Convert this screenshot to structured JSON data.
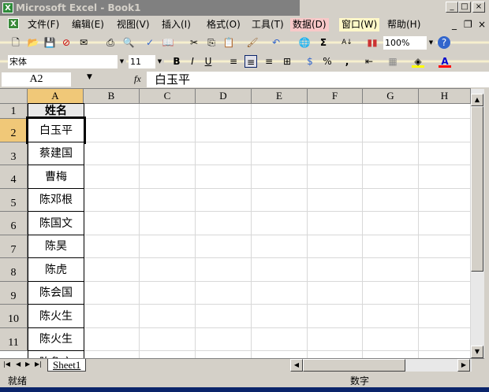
{
  "window": {
    "title": "Microsoft Excel - Book1"
  },
  "menu": [
    {
      "label": "文件(F)"
    },
    {
      "label": "编辑(E)"
    },
    {
      "label": "视图(V)"
    },
    {
      "label": "插入(I)"
    },
    {
      "label": "格式(O)"
    },
    {
      "label": "工具(T)"
    },
    {
      "label": "数据(D)"
    },
    {
      "label": "窗口(W)"
    },
    {
      "label": "帮助(H)"
    }
  ],
  "toolbar": {
    "zoom": "100%",
    "font": "宋体",
    "size": "11",
    "bold": "B",
    "italic": "I",
    "underline": "U",
    "percent": "%",
    "comma": ",",
    "sum": "Σ",
    "font_color_icon": "A",
    "highlight_color": "#ffff00",
    "font_color": "#ff0000"
  },
  "formula": {
    "name_box": "A2",
    "fx": "fx",
    "value": "白玉平"
  },
  "columns": [
    "A",
    "B",
    "C",
    "D",
    "E",
    "F",
    "G",
    "H"
  ],
  "rows": [
    "1",
    "2",
    "3",
    "4",
    "5",
    "6",
    "7",
    "8",
    "9",
    "10",
    "11"
  ],
  "cells": [
    "姓名",
    "白玉平",
    "蔡建国",
    "曹梅",
    "陈邓根",
    "陈国文",
    "陈昊",
    "陈虎",
    "陈会国",
    "陈火生",
    "陈火生",
    "陈鲁文"
  ],
  "sheet_tab": "Sheet1",
  "status": {
    "left": "就绪",
    "right": "数字"
  }
}
